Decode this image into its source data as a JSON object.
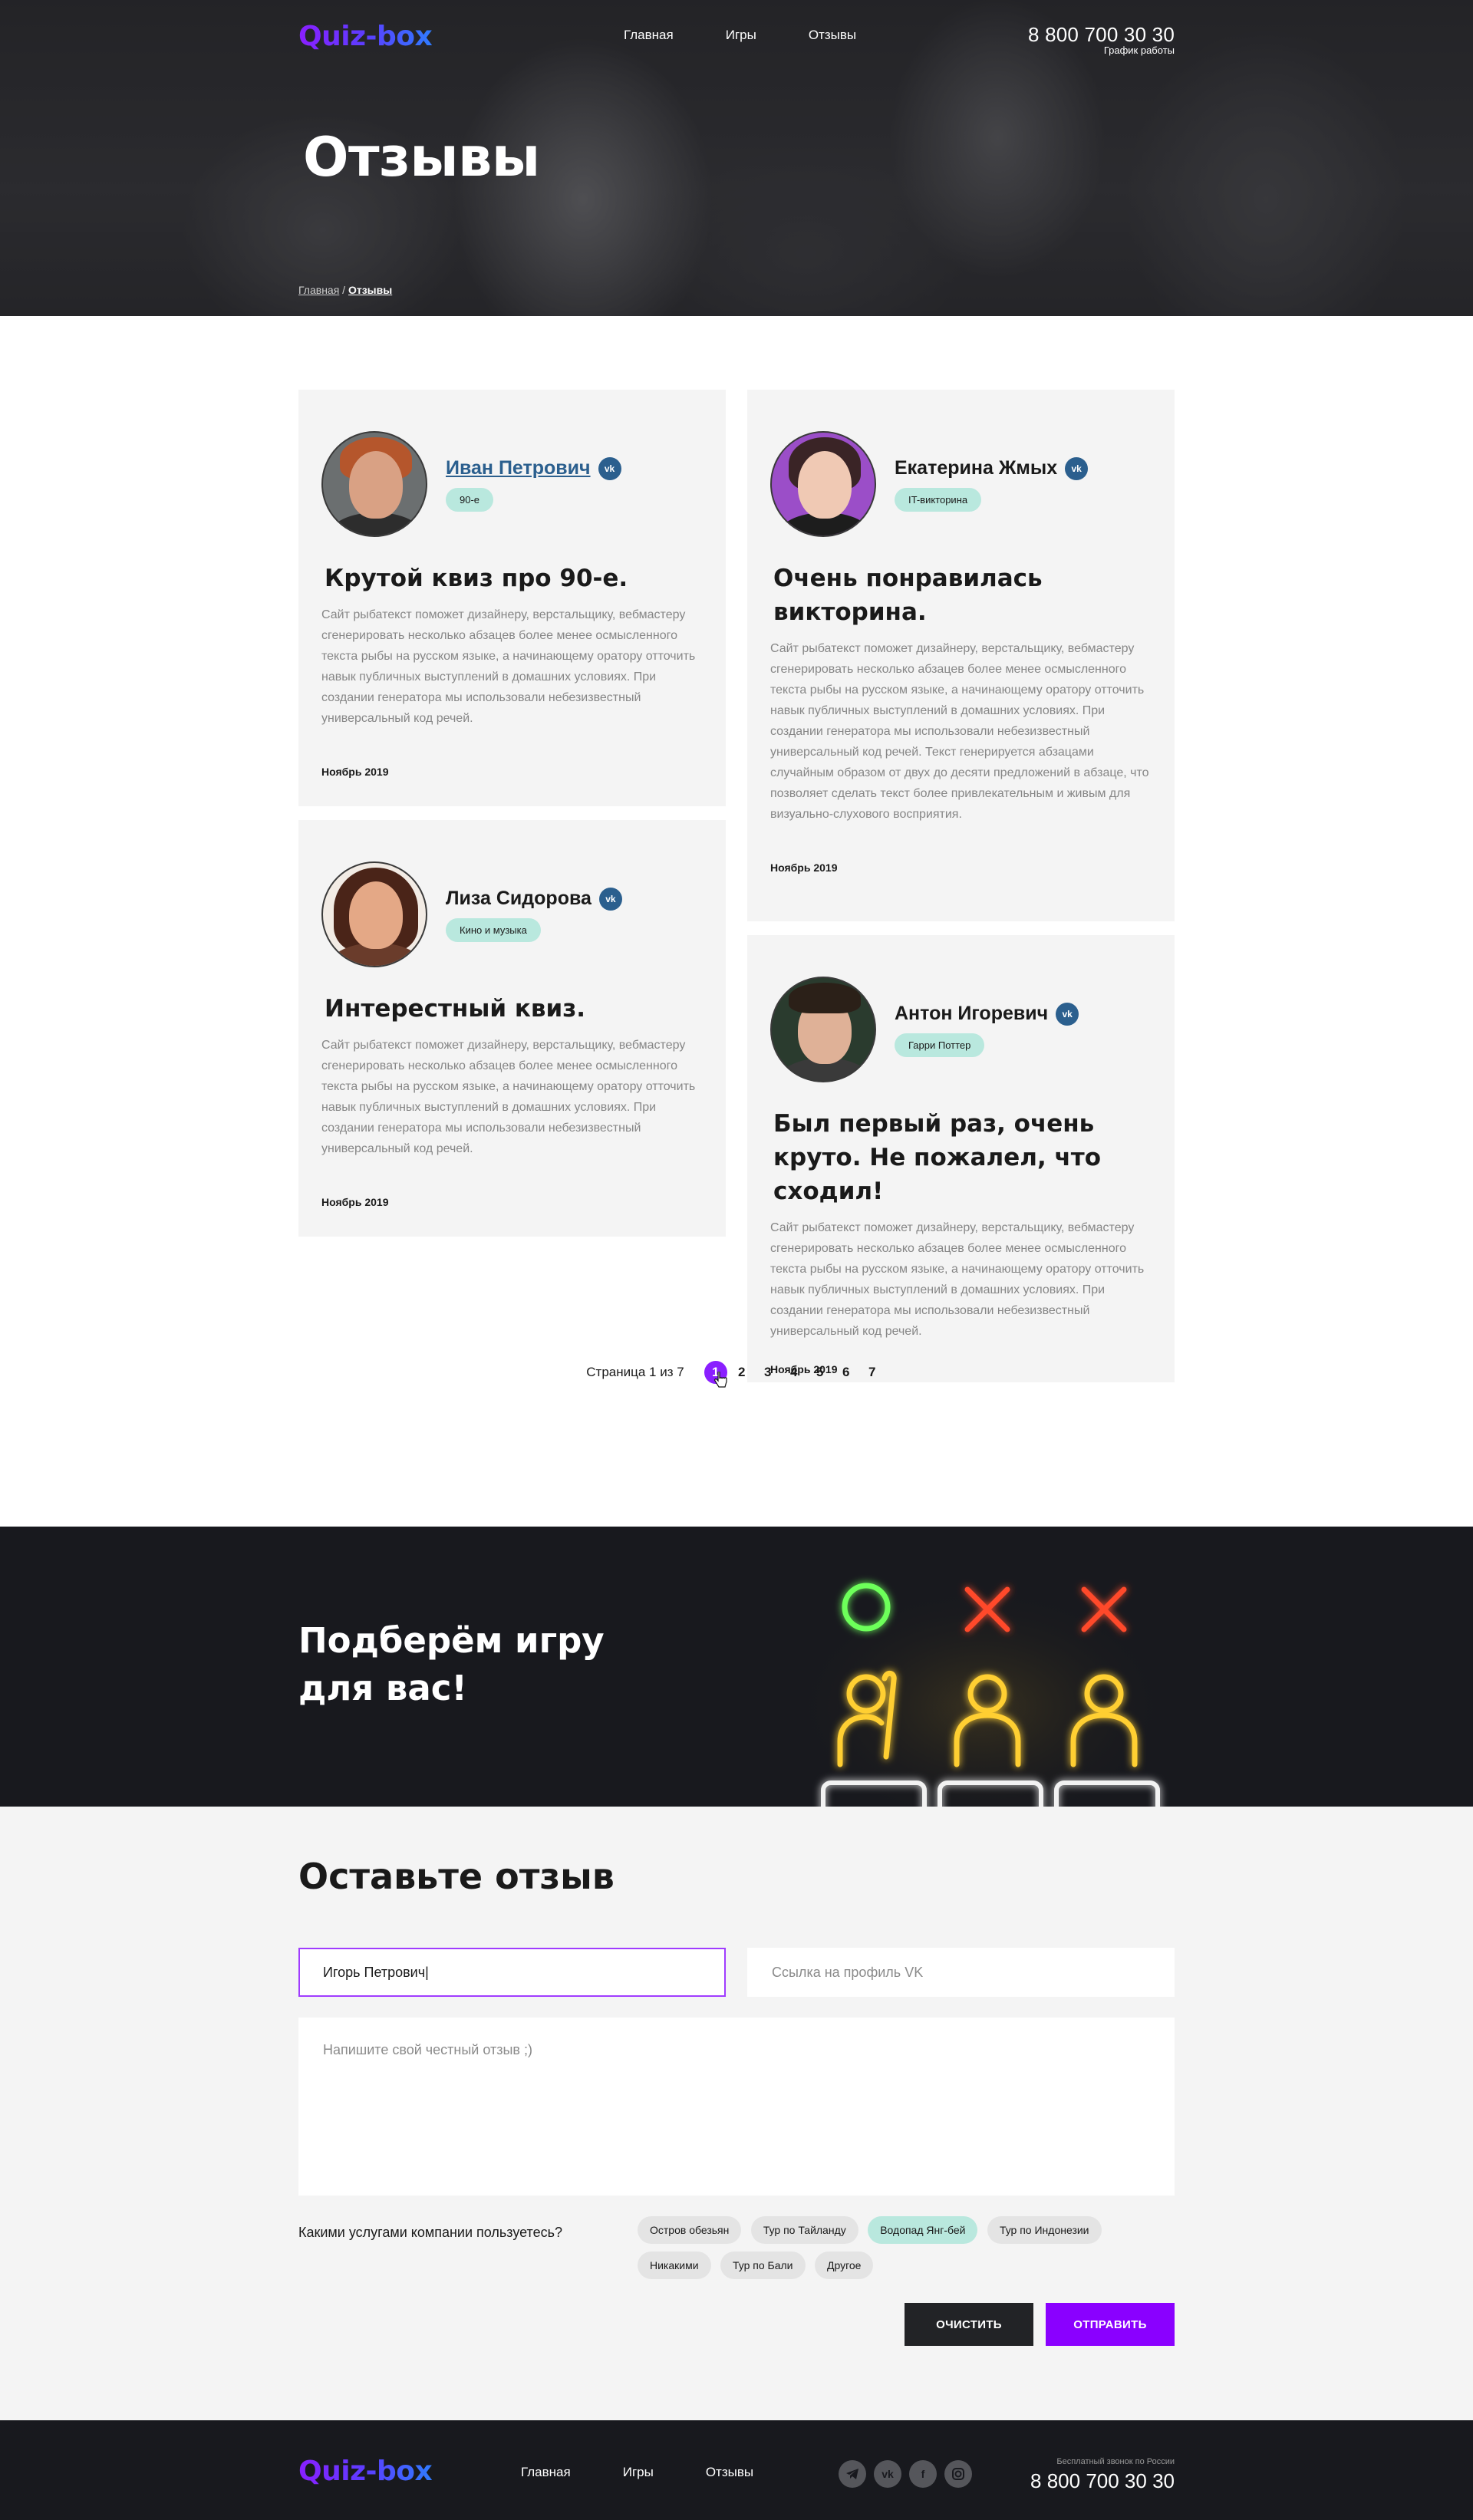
{
  "header": {
    "logo": "Quiz-box",
    "menu": [
      "Главная",
      "Игры",
      "Отзывы"
    ],
    "phone": "8 800 700 30 30",
    "schedule": "График работы"
  },
  "hero": {
    "title": "Отзывы",
    "breadcrumb_home": "Главная",
    "breadcrumb_sep": " / ",
    "breadcrumb_current": "Отзывы"
  },
  "reviews": [
    {
      "name": "Иван Петрович",
      "vk": "vk",
      "tag": "90-е",
      "title": "Крутой квиз про 90-е.",
      "text": "Сайт рыбатекст поможет дизайнеру, верстальщику, вебмастеру сгенерировать несколько абзацев более менее осмысленного текста рыбы на русском языке, а начинающему оратору отточить навык публичных выступлений в домашних условиях. При создании генератора мы использовали небезизвестный универсальный код речей.",
      "date": "Ноябрь 2019"
    },
    {
      "name": "Екатерина Жмых",
      "vk": "vk",
      "tag": "IT-викторина",
      "title": "Очень понравилась викторина.",
      "text": "Сайт рыбатекст поможет дизайнеру, верстальщику, вебмастеру сгенерировать несколько абзацев более менее осмысленного текста рыбы на русском языке, а начинающему оратору отточить навык публичных выступлений в домашних условиях. При создании генератора мы использовали небезизвестный универсальный код речей. Текст генерируется абзацами случайным образом от двух до десяти предложений в абзаце, что позволяет сделать текст более привлекательным и живым для визуально-слухового восприятия.",
      "date": "Ноябрь 2019"
    },
    {
      "name": "Лиза Сидорова",
      "vk": "vk",
      "tag": "Кино и музыка",
      "title": "Интерестный квиз.",
      "text": "Сайт рыбатекст поможет дизайнеру, верстальщику, вебмастеру сгенерировать несколько абзацев более менее осмысленного текста рыбы на русском языке, а начинающему оратору отточить навык публичных выступлений в домашних условиях. При создании генератора мы использовали небезизвестный универсальный код речей.",
      "date": "Ноябрь 2019"
    },
    {
      "name": "Антон Игоревич",
      "vk": "vk",
      "tag": "Гарри Поттер",
      "title": "Был первый раз, очень круто. Не пожалел, что сходил!",
      "text": "Сайт рыбатекст поможет дизайнеру, верстальщику, вебмастеру сгенерировать несколько абзацев более менее осмысленного текста рыбы на русском языке, а начинающему оратору отточить навык публичных выступлений в домашних условиях. При создании генератора мы использовали небезизвестный универсальный код речей.",
      "date": "Ноябрь 2019"
    }
  ],
  "pagination": {
    "label": "Страница 1 из 7",
    "pages": [
      "1",
      "2",
      "3",
      "4",
      "5",
      "6",
      "7"
    ],
    "current": "1"
  },
  "promo": {
    "title_line1": "Подберём игру",
    "title_line2": "для вас!",
    "icon": "neon-quiz-players-icon"
  },
  "form": {
    "title": "Оставьте отзыв",
    "name_value": "Игорь Петрович|",
    "vk_placeholder": "Ссылка на профиль VK",
    "review_placeholder": "Напишите свой честный отзыв ;)",
    "services_question": "Какими услугами компании пользуетесь?",
    "services": [
      "Остров обезьян",
      "Тур по Тайланду",
      "Водопад Янг-бей",
      "Тур по Индонезии",
      "Никакими",
      "Тур по Бали",
      "Другое"
    ],
    "selected_service": "Водопад Янг-бей",
    "clear_label": "ОЧИСТИТЬ",
    "send_label": "ОТПРАВИТЬ"
  },
  "footer": {
    "logo": "Quiz-box",
    "menu": [
      "Главная",
      "Игры",
      "Отзывы"
    ],
    "socials": [
      "telegram-icon",
      "vk-icon",
      "facebook-icon",
      "instagram-icon"
    ],
    "free_call": "Бесплатный звонок по России",
    "phone": "8 800 700 30 30"
  },
  "colors": {
    "accent": "#8a00ff",
    "tag_bg": "#b9e8de",
    "dark": "#18191e",
    "link": "#2b5f8e"
  }
}
